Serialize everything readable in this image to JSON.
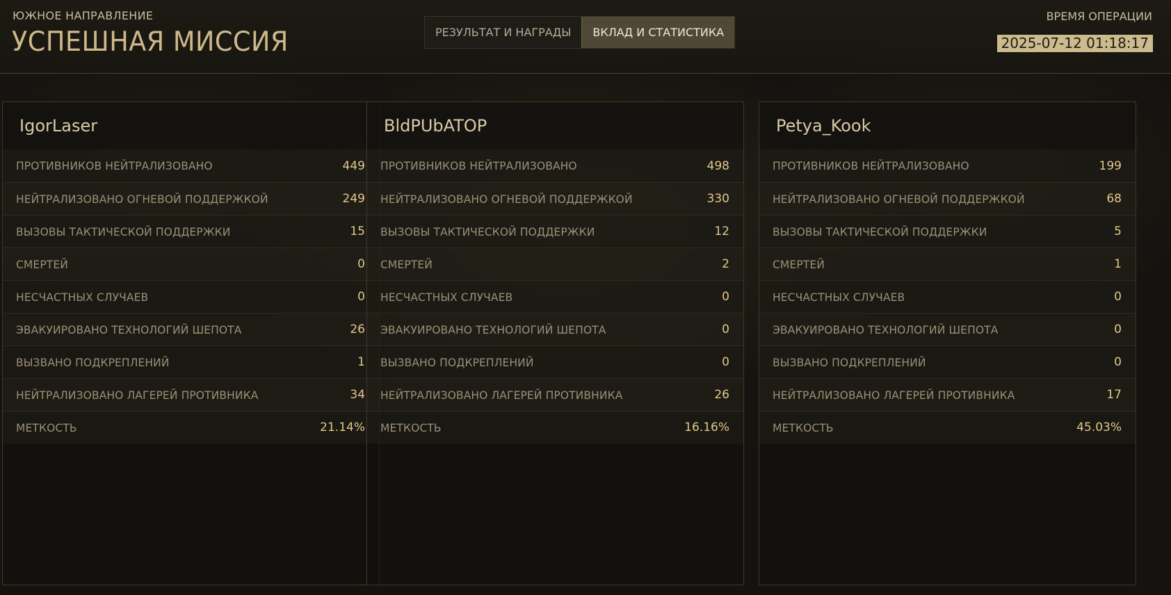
{
  "header": {
    "subtitle": "ЮЖНОЕ НАПРАВЛЕНИЕ",
    "title": "УСПЕШНАЯ МИССИЯ",
    "tabs": [
      {
        "label": "РЕЗУЛЬТАТ И НАГРАДЫ",
        "active": false
      },
      {
        "label": "ВКЛАД И СТАТИСТИКА",
        "active": true
      }
    ],
    "operation_time_label": "ВРЕМЯ ОПЕРАЦИИ",
    "operation_time_value": "2025-07-12 01:18:17"
  },
  "stat_labels": [
    "ПРОТИВНИКОВ НЕЙТРАЛИЗОВАНО",
    "НЕЙТРАЛИЗОВАНО ОГНЕВОЙ ПОДДЕРЖКОЙ",
    "ВЫЗОВЫ ТАКТИЧЕСКОЙ ПОДДЕРЖКИ",
    "СМЕРТЕЙ",
    "НЕСЧАСТНЫХ СЛУЧАЕВ",
    "ЭВАКУИРОВАНО ТЕХНОЛОГИЙ ШЕПОТА",
    "ВЫЗВАНО ПОДКРЕПЛЕНИЙ",
    "НЕЙТРАЛИЗОВАНО ЛАГЕРЕЙ ПРОТИВНИКА",
    "МЕТКОСТЬ"
  ],
  "players": [
    {
      "name": "IgorLaser",
      "stats": [
        "449",
        "249",
        "15",
        "0",
        "0",
        "26",
        "1",
        "34",
        "21.14%"
      ]
    },
    {
      "name": "BldPUbATOP",
      "stats": [
        "498",
        "330",
        "12",
        "2",
        "0",
        "0",
        "0",
        "26",
        "16.16%"
      ]
    },
    {
      "name": "Petya_Kook",
      "stats": [
        "199",
        "68",
        "5",
        "1",
        "0",
        "0",
        "0",
        "17",
        "45.03%"
      ]
    }
  ],
  "colors": {
    "accent": "#cbbb8d",
    "value": "#e2c88c",
    "background": "#15130f"
  }
}
